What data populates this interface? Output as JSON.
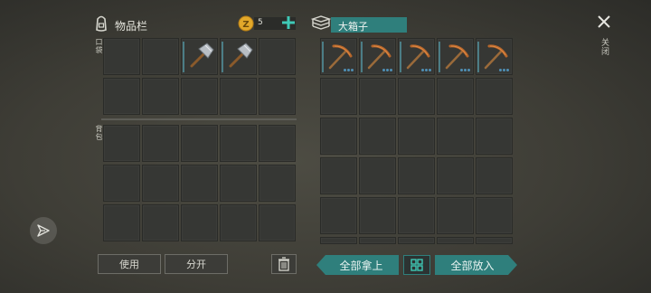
{
  "colors": {
    "accent": "#2f7f7c",
    "coin": "#e2a82a",
    "slot": "#363734",
    "add": "#3fc9b6"
  },
  "inventory": {
    "title": "物品栏",
    "title_icon": "backpack-icon",
    "coins": "5",
    "coin_icon": "coin-icon",
    "add_icon": "plus-icon",
    "pocket_label": "口袋",
    "backpack_label": "背包"
  },
  "chest": {
    "title": "大箱子",
    "title_icon": "books-icon",
    "items": [
      {
        "name": "pickaxe"
      },
      {
        "name": "pickaxe"
      },
      {
        "name": "pickaxe"
      },
      {
        "name": "pickaxe"
      },
      {
        "name": "pickaxe"
      }
    ]
  },
  "pocket_items": [
    {
      "slot": 2,
      "name": "hammer"
    },
    {
      "slot": 3,
      "name": "hammer"
    }
  ],
  "buttons": {
    "use": "使用",
    "split": "分开",
    "take_all": "全部拿上",
    "put_all": "全部放入",
    "close_label": "关闭",
    "trash_icon": "trash-icon",
    "sort_icon": "sort-grid-icon",
    "close_icon": "close-icon"
  },
  "side": {
    "send_icon": "send-icon"
  }
}
